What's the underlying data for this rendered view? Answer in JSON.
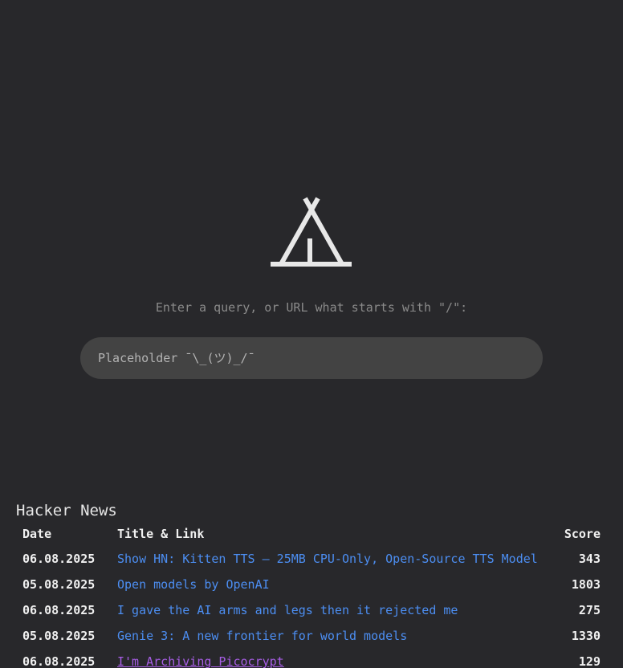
{
  "logo": {
    "icon": "tent-icon",
    "color": "#e8e8e8"
  },
  "prompt": "Enter a query, or URL what starts with \"/\":",
  "search": {
    "placeholder": "Placeholder ¯\\_(ツ)_/¯",
    "value": ""
  },
  "hn": {
    "heading": "Hacker News",
    "columns": {
      "date": "Date",
      "title": "Title & Link",
      "score": "Score"
    },
    "rows": [
      {
        "date": "06.08.2025",
        "title": "Show HN: Kitten TTS – 25MB CPU-Only, Open-Source TTS Model",
        "score": "343",
        "visited": false
      },
      {
        "date": "05.08.2025",
        "title": "Open models by OpenAI",
        "score": "1803",
        "visited": false
      },
      {
        "date": "06.08.2025",
        "title": "I gave the AI arms and legs then it rejected me",
        "score": "275",
        "visited": false
      },
      {
        "date": "05.08.2025",
        "title": "Genie 3: A new frontier for world models",
        "score": "1330",
        "visited": false
      },
      {
        "date": "06.08.2025",
        "title": "I'm Archiving Picocrypt",
        "score": "129",
        "visited": true
      }
    ],
    "colors": {
      "link": "#4c8ef2",
      "visited": "#a85ee6"
    }
  }
}
